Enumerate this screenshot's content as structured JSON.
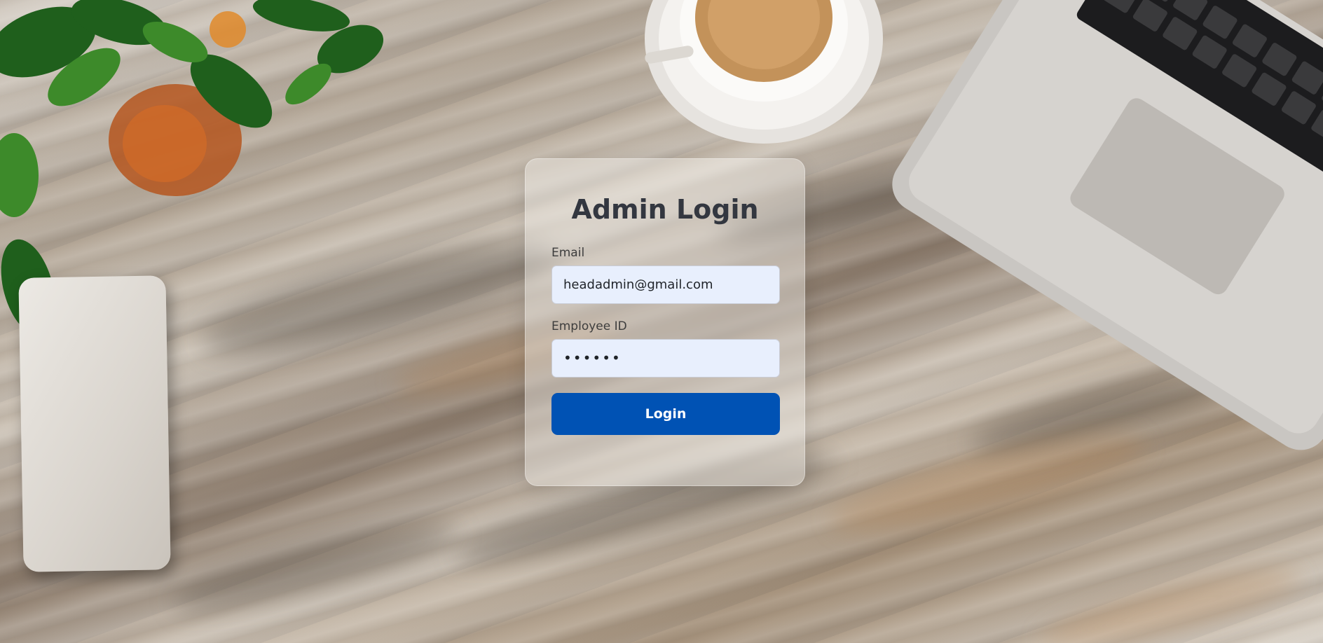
{
  "login_form": {
    "title": "Admin Login",
    "email_label": "Email",
    "email_value": "headadmin@gmail.com",
    "employee_id_label": "Employee ID",
    "employee_id_value": "••••••",
    "submit_label": "Login"
  },
  "colors": {
    "button_background": "#0052b4",
    "input_background": "#e8effd",
    "title_text": "#333740"
  },
  "background_objects": [
    "potted-plant",
    "coffee-cup",
    "laptop",
    "smartphone",
    "wooden-desk"
  ]
}
